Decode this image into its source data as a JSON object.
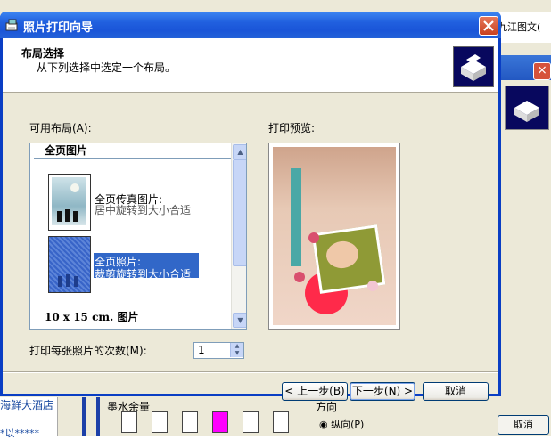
{
  "dialog": {
    "title": "照片打印向导",
    "header_title": "布局选择",
    "header_subtitle": "从下列选择中选定一个布局。"
  },
  "layouts": {
    "label": "可用布局(A):",
    "group_header": "全页图片",
    "items": [
      {
        "line1": "全页传真图片:",
        "line2": "居中旋转到大小合适"
      },
      {
        "line1": "全页照片:",
        "line2": "裁剪旋转到大小合适"
      }
    ],
    "footer_group": "10 x 15 cm. 图片"
  },
  "preview": {
    "label": "打印预览:"
  },
  "copies": {
    "label": "打印每张照片的次数(M):",
    "value": "1"
  },
  "buttons": {
    "back": "< 上一步(B)",
    "next": "下一步(N) >",
    "cancel": "取消"
  },
  "background": {
    "window_title_fragment": "九江图文(",
    "hotel_text": "海鲜大酒店",
    "hotel_text2": "*以*****",
    "ink_label": "墨水余量",
    "direction_label": "方向",
    "portrait_label": "纵向(P)",
    "cancel_label": "取消"
  },
  "icons": {
    "title": "photo-print-wizard-icon",
    "header": "printer-icon",
    "close": "close-icon"
  },
  "colors": {
    "titlebar": "#2160df",
    "selection": "#3167c8",
    "dialog_bg": "#ece9d8"
  }
}
